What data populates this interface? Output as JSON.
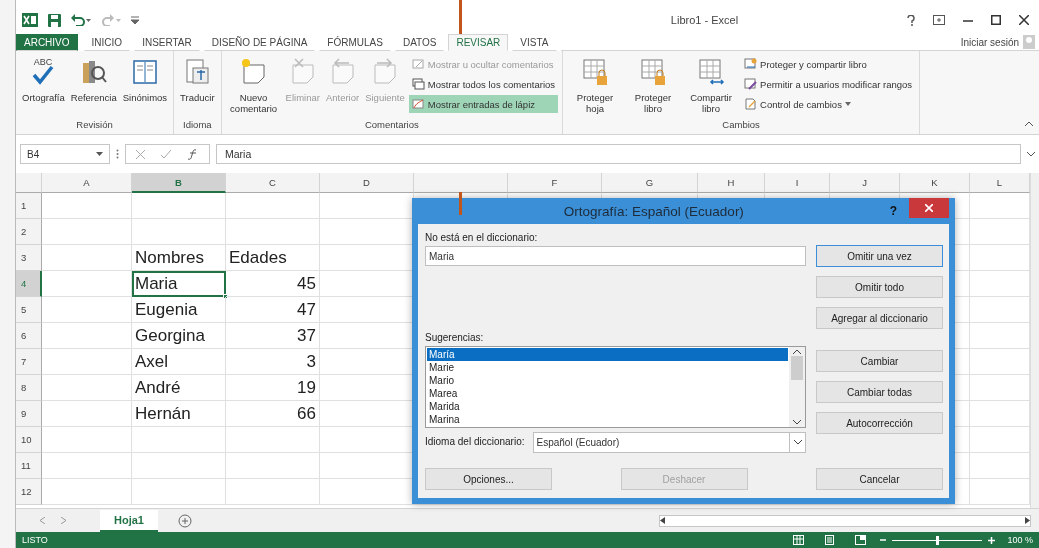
{
  "window": {
    "title": "Libro1 - Excel",
    "sign_in": "Iniciar sesión"
  },
  "ribbon_tabs": [
    {
      "label": "ARCHIVO",
      "kind": "file",
      "selected": false
    },
    {
      "label": "INICIO",
      "kind": "tab",
      "selected": false
    },
    {
      "label": "INSERTAR",
      "kind": "tab",
      "selected": false
    },
    {
      "label": "DISEÑO DE PÁGINA",
      "kind": "tab",
      "selected": false
    },
    {
      "label": "FÓRMULAS",
      "kind": "tab",
      "selected": false
    },
    {
      "label": "DATOS",
      "kind": "tab",
      "selected": false
    },
    {
      "label": "REVISAR",
      "kind": "tab",
      "selected": true
    },
    {
      "label": "VISTA",
      "kind": "tab",
      "selected": false
    }
  ],
  "ribbon_groups": [
    {
      "label": "Revisión",
      "buttons": [
        {
          "label": "Ortografía",
          "icon_text": "ABC",
          "kind": "large",
          "disabled": false
        },
        {
          "label": "Referencia",
          "kind": "large",
          "disabled": false
        },
        {
          "label": "Sinónimos",
          "kind": "large",
          "disabled": false
        }
      ]
    },
    {
      "label": "Idioma",
      "buttons": [
        {
          "label": "Traducir",
          "kind": "large",
          "disabled": false
        }
      ]
    },
    {
      "label": "Comentarios",
      "buttons": [
        {
          "label": "Nuevo comentario",
          "kind": "large",
          "disabled": false
        },
        {
          "label": "Eliminar",
          "kind": "large",
          "disabled": true
        },
        {
          "label": "Anterior",
          "kind": "large",
          "disabled": true
        },
        {
          "label": "Siguiente",
          "kind": "large",
          "disabled": true
        },
        {
          "label": "Mostrar u ocultar comentarios",
          "kind": "small",
          "disabled": true,
          "selected": false
        },
        {
          "label": "Mostrar todos los comentarios",
          "kind": "small",
          "disabled": false,
          "selected": false
        },
        {
          "label": "Mostrar entradas de lápiz",
          "kind": "small",
          "disabled": false,
          "selected": true
        }
      ]
    },
    {
      "label": "Cambios",
      "buttons": [
        {
          "label": "Proteger hoja",
          "kind": "large",
          "disabled": false
        },
        {
          "label": "Proteger libro",
          "kind": "large",
          "disabled": false
        },
        {
          "label": "Compartir libro",
          "kind": "large",
          "disabled": false
        },
        {
          "label": "Proteger y compartir libro",
          "kind": "small",
          "disabled": false,
          "selected": false
        },
        {
          "label": "Permitir a usuarios modificar rangos",
          "kind": "small",
          "disabled": false,
          "selected": false
        },
        {
          "label": "Control de cambios",
          "kind": "small",
          "disabled": false,
          "selected": false,
          "dropdown": true
        }
      ]
    }
  ],
  "formula_bar": {
    "name_box": "B4",
    "value": "Maria"
  },
  "sheet": {
    "columns": [
      {
        "label": "A",
        "selected": false
      },
      {
        "label": "B",
        "selected": true
      },
      {
        "label": "C",
        "selected": false
      },
      {
        "label": "D",
        "selected": false
      },
      {
        "selected": false
      },
      {
        "label": "F",
        "selected": false
      },
      {
        "label": "G",
        "selected": false
      },
      {
        "label": "H",
        "selected": false
      },
      {
        "label": "I",
        "selected": false
      },
      {
        "label": "J",
        "selected": false
      },
      {
        "label": "K",
        "selected": false
      },
      {
        "label": "L",
        "selected": false
      }
    ],
    "rows": [
      {
        "number": "1",
        "selected": false,
        "cells": []
      },
      {
        "number": "2",
        "selected": false,
        "cells": []
      },
      {
        "number": "3",
        "selected": false,
        "cells": [
          {
            "text": "",
            "kind": "text",
            "selected": false
          },
          {
            "text": "Nombres",
            "kind": "text",
            "selected": false
          },
          {
            "text": "Edades",
            "kind": "text",
            "selected": false
          }
        ]
      },
      {
        "number": "4",
        "selected": true,
        "cells": [
          {
            "text": "",
            "kind": "text",
            "selected": false
          },
          {
            "text": "Maria",
            "kind": "text",
            "selected": true
          },
          {
            "text": "45",
            "kind": "number",
            "selected": false
          }
        ]
      },
      {
        "number": "5",
        "selected": false,
        "cells": [
          {
            "text": "",
            "kind": "text",
            "selected": false
          },
          {
            "text": "Eugenia",
            "kind": "text",
            "selected": false
          },
          {
            "text": "47",
            "kind": "number",
            "selected": false
          }
        ]
      },
      {
        "number": "6",
        "selected": false,
        "cells": [
          {
            "text": "",
            "kind": "text",
            "selected": false
          },
          {
            "text": "Georgina",
            "kind": "text",
            "selected": false
          },
          {
            "text": "37",
            "kind": "number",
            "selected": false
          }
        ]
      },
      {
        "number": "7",
        "selected": false,
        "cells": [
          {
            "text": "",
            "kind": "text",
            "selected": false
          },
          {
            "text": "Axel",
            "kind": "text",
            "selected": false
          },
          {
            "text": "3",
            "kind": "number",
            "selected": false
          }
        ]
      },
      {
        "number": "8",
        "selected": false,
        "cells": [
          {
            "text": "",
            "kind": "text",
            "selected": false
          },
          {
            "text": "André",
            "kind": "text",
            "selected": false
          },
          {
            "text": "19",
            "kind": "number",
            "selected": false
          }
        ]
      },
      {
        "number": "9",
        "selected": false,
        "cells": [
          {
            "text": "",
            "kind": "text",
            "selected": false
          },
          {
            "text": "Hernán",
            "kind": "text",
            "selected": false
          },
          {
            "text": "66",
            "kind": "number",
            "selected": false
          }
        ]
      },
      {
        "number": "10",
        "selected": false,
        "cells": []
      },
      {
        "number": "11",
        "selected": false,
        "cells": []
      },
      {
        "number": "12",
        "selected": false,
        "cells": []
      }
    ],
    "tabs": [
      {
        "label": "Hoja1",
        "selected": true
      }
    ]
  },
  "dialog": {
    "title": "Ortografía: Español (Ecuador)",
    "help": "?",
    "not_in_dictionary_label": "No está en el diccionario:",
    "word": "Maria",
    "suggestions_label": "Sugerencias:",
    "suggestions": [
      {
        "text": "María",
        "selected": true
      },
      {
        "text": "Marie",
        "selected": false
      },
      {
        "text": "Mario",
        "selected": false
      },
      {
        "text": "Marea",
        "selected": false
      },
      {
        "text": "Marida",
        "selected": false
      },
      {
        "text": "Marina",
        "selected": false
      }
    ],
    "language_label": "Idioma del diccionario:",
    "language": "Español (Ecuador)",
    "side_button_groups": [
      {
        "buttons": [
          {
            "label": "Omitir una vez",
            "default": true
          },
          {
            "label": "Omitir todo",
            "default": false
          },
          {
            "label": "Agregar al diccionario",
            "default": false
          }
        ]
      },
      {
        "buttons": [
          {
            "label": "Cambiar",
            "default": false
          },
          {
            "label": "Cambiar todas",
            "default": false
          },
          {
            "label": "Autocorrección",
            "default": false
          }
        ]
      }
    ],
    "bottom_buttons": [
      {
        "label": "Opciones...",
        "disabled": false
      },
      {
        "label": "Deshacer",
        "disabled": true
      },
      {
        "label": "Cancelar",
        "disabled": false
      }
    ]
  },
  "status_bar": {
    "status": "LISTO",
    "zoom": "100 %",
    "zoom_slider": {
      "level": 0.5
    }
  }
}
